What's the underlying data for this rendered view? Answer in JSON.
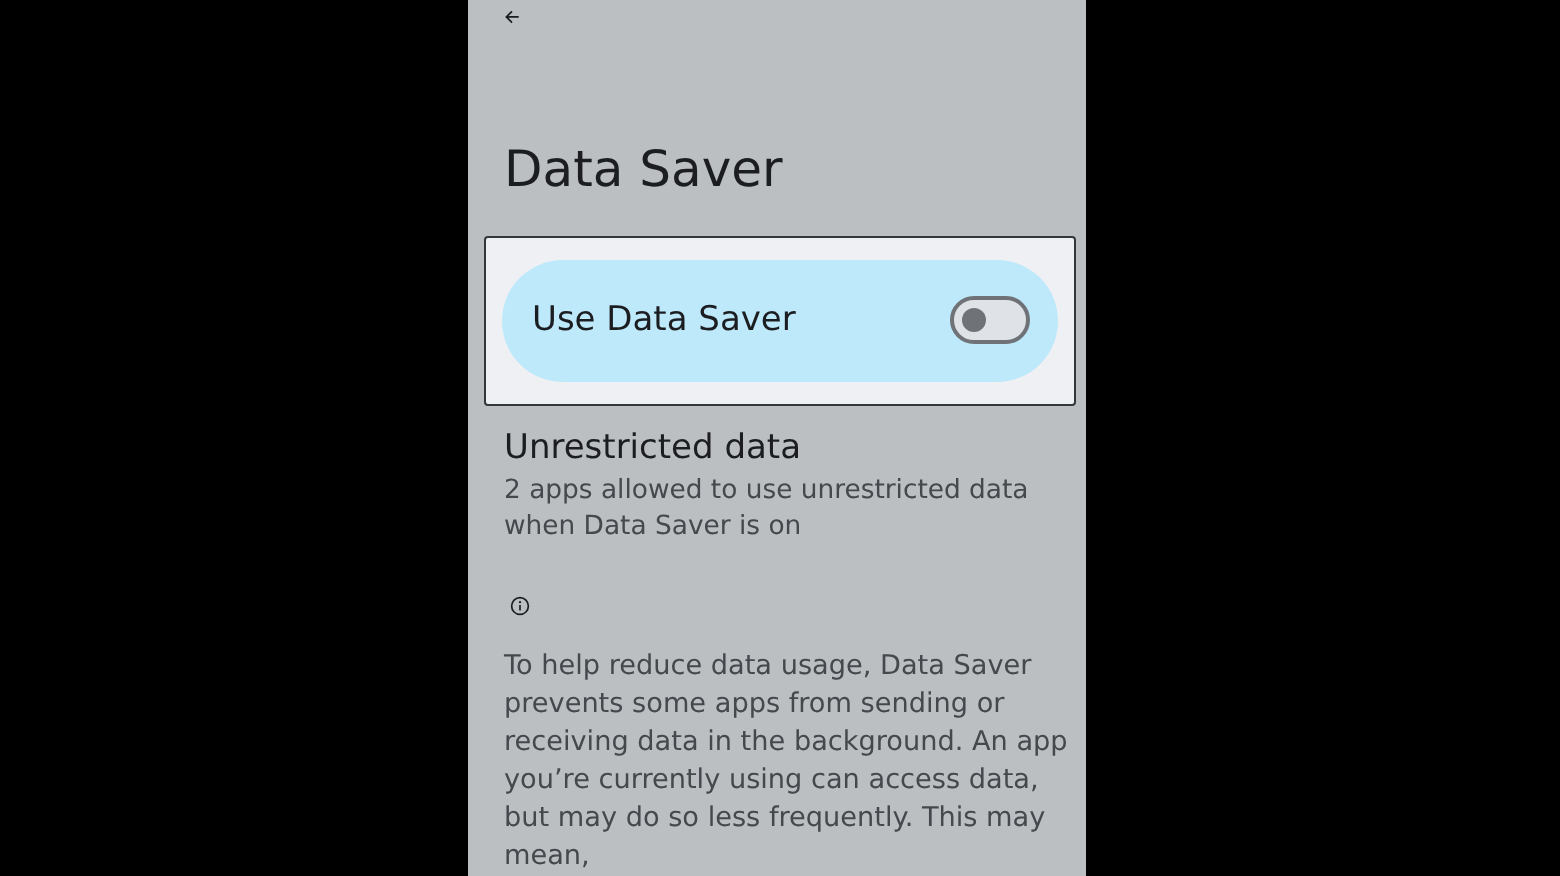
{
  "title": "Data Saver",
  "main_switch": {
    "label": "Use Data Saver",
    "checked": false,
    "focused": true
  },
  "unrestricted": {
    "title": "Unrestricted data",
    "summary": "2 apps allowed to use unrestricted data when Data Saver is on"
  },
  "footer": {
    "text": "To help reduce data usage, Data Saver prevents some apps from sending or receiving data in the background. An app you’re currently using can access data, but may do so less frequently. This may mean,"
  }
}
